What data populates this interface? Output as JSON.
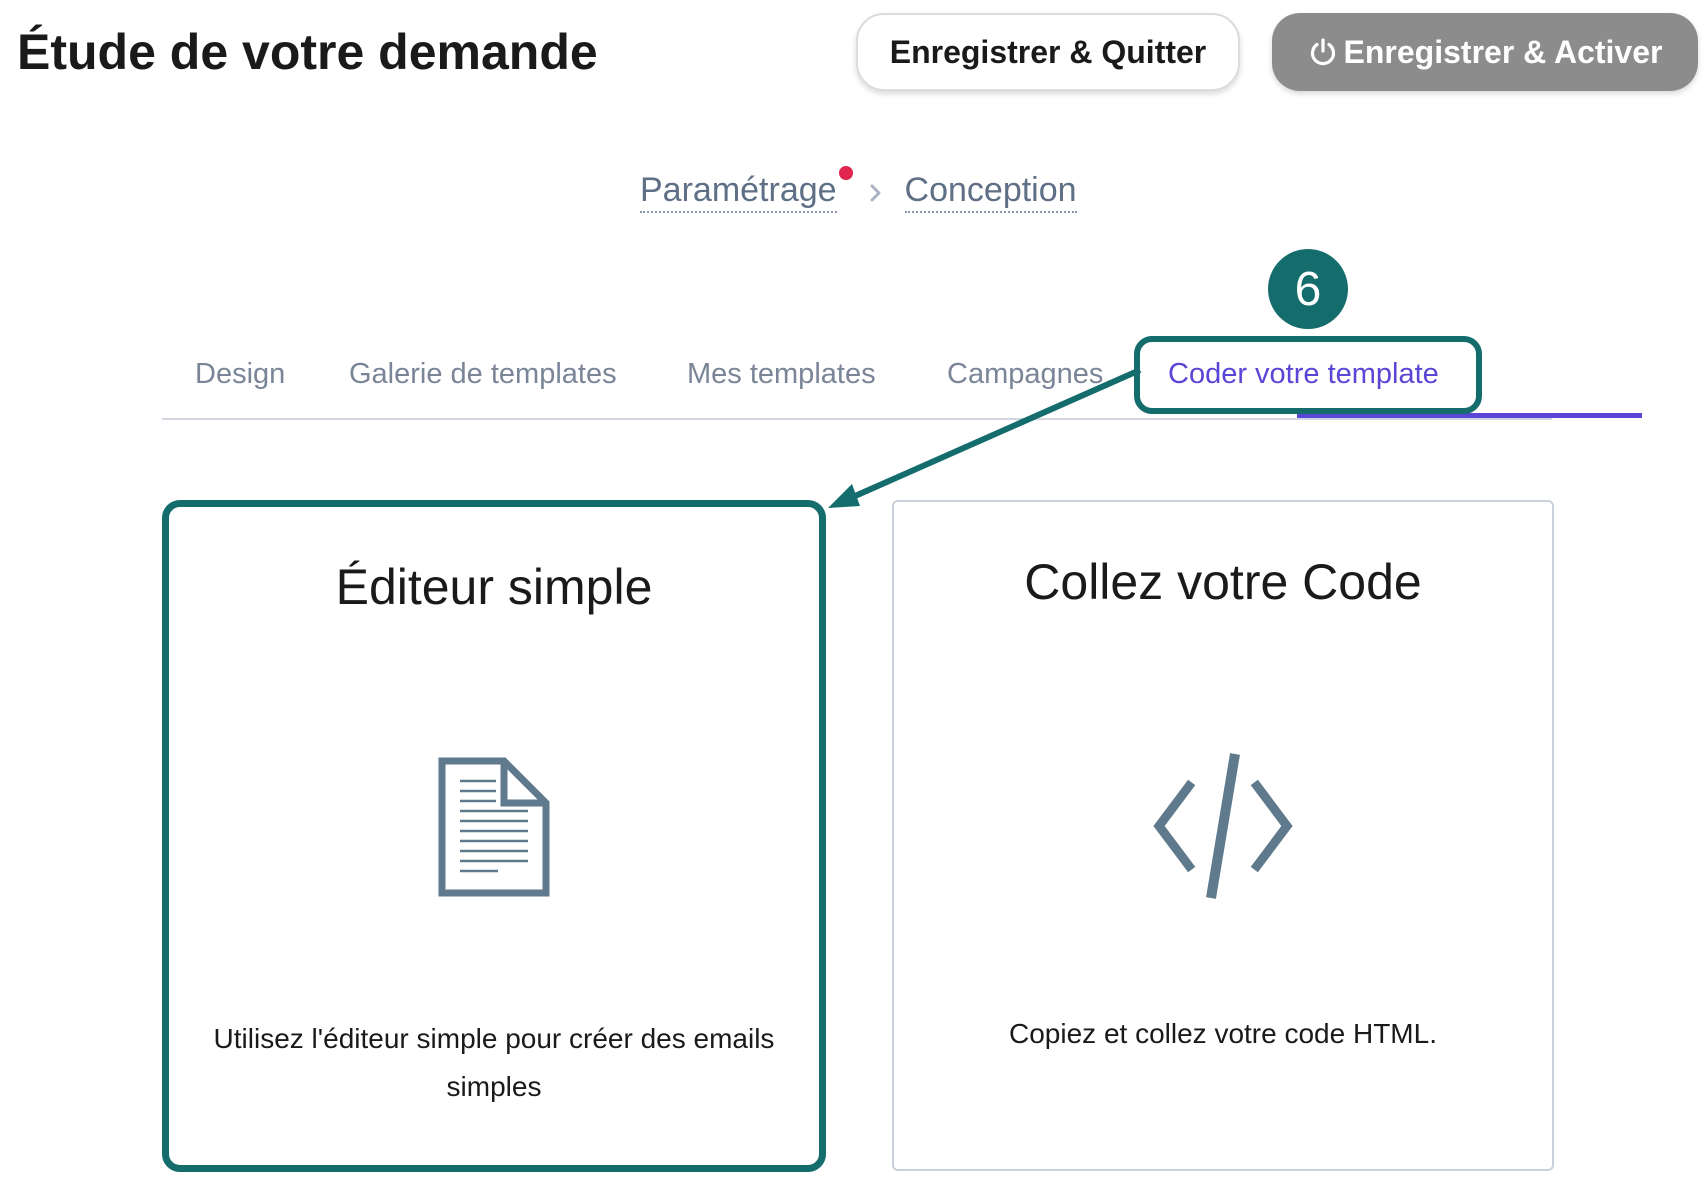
{
  "header": {
    "title": "Étude de votre demande",
    "save_quit_label": "Enregistrer & Quitter",
    "save_activate_label": "Enregistrer & Activer"
  },
  "breadcrumb": {
    "items": [
      {
        "label": "Paramétrage",
        "has_alert_dot": true
      },
      {
        "label": "Conception",
        "has_alert_dot": false
      }
    ]
  },
  "annotation": {
    "step_number": "6"
  },
  "tabs": [
    {
      "label": "Design",
      "active": false
    },
    {
      "label": "Galerie de templates",
      "active": false
    },
    {
      "label": "Mes templates",
      "active": false
    },
    {
      "label": "Campagnes",
      "active": false
    },
    {
      "label": "Coder votre template",
      "active": true
    }
  ],
  "cards": [
    {
      "title": "Éditeur simple",
      "icon": "document-icon",
      "description": "Utilisez l'éditeur simple pour créer des emails simples",
      "highlighted": true
    },
    {
      "title": "Collez votre Code",
      "icon": "code-icon",
      "description": "Copiez et collez votre code HTML.",
      "highlighted": false
    }
  ],
  "colors": {
    "accent": "#5a46d6",
    "annotation": "#146c6c",
    "alert_dot": "#e0264f",
    "disabled_button": "#8c8c8c",
    "icon": "#5f7a8c"
  }
}
